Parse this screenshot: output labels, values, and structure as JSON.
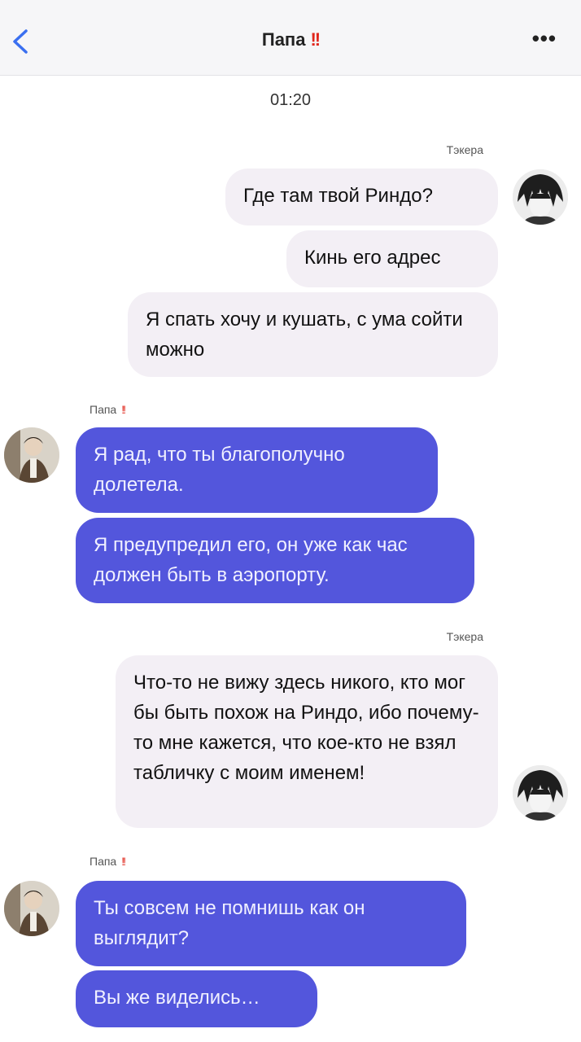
{
  "header": {
    "title": "Папа",
    "title_mark": "!!",
    "more": "•••",
    "back_icon": "chevron-left-icon"
  },
  "time": "01:20",
  "groups": {
    "g1_sender": "Тэкера",
    "g2_sender": "Папа",
    "g2_mark": "!!",
    "g3_sender": "Тэкера",
    "g4_sender": "Папа",
    "g4_mark": "!!"
  },
  "messages": {
    "m1": "Где там твой Риндо?",
    "m2": "Кинь его адрес",
    "m3": "Я спать хочу и кушать, с ума сойти можно",
    "m4": "Я рад, что ты благополучно долетела.",
    "m5": "Я предупредил его, он уже как час должен быть в аэропорту.",
    "m6": "Что-то не вижу здесь никого, кто мог бы быть похож на Риндо, ибо почему-то мне кажется, что кое-кто не взял табличку с моим именем!",
    "m7": "Ты совсем не помнишь как он выглядит?",
    "m8": "Вы же виделись…"
  },
  "colors": {
    "outgoing_bubble": "#f3eff5",
    "incoming_bubble": "#5356dc",
    "accent_back": "#3a6ff0",
    "mark_red": "#e0261b"
  }
}
